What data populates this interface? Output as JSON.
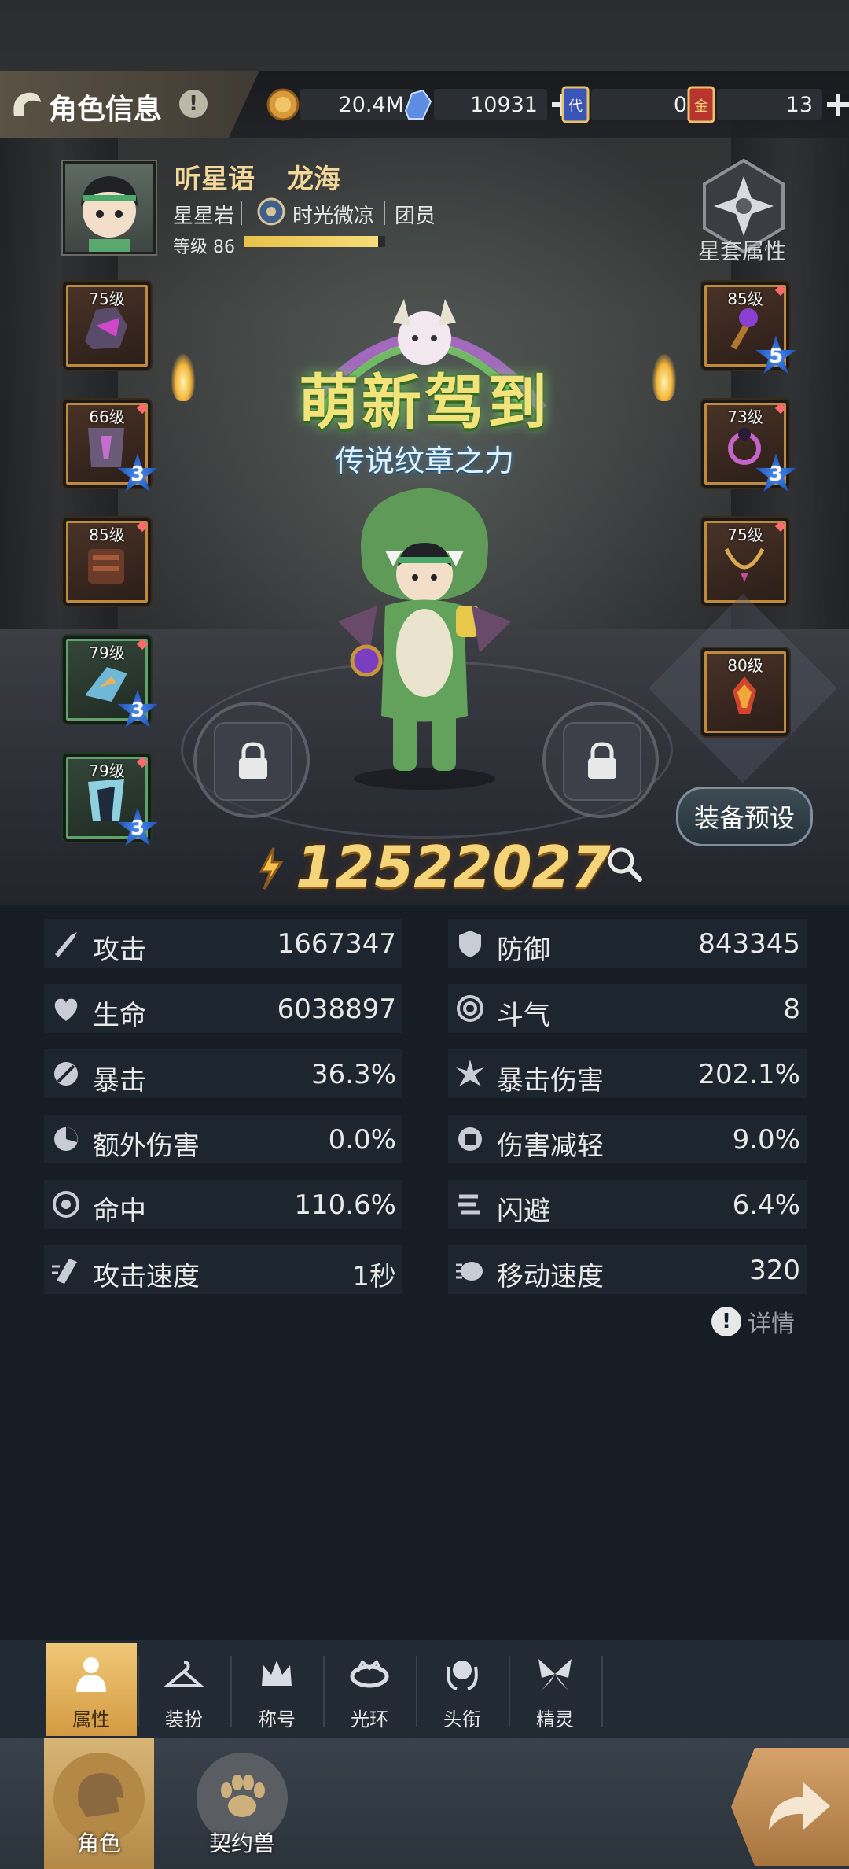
{
  "header": {
    "title": "角色信息",
    "resources": [
      {
        "icon": "gold-coin-icon",
        "value": "20.4M",
        "has_plus": false
      },
      {
        "icon": "blue-crystal-icon",
        "value": "10931",
        "has_plus": true
      },
      {
        "icon": "blue-card-icon",
        "value": "0",
        "has_plus": false
      },
      {
        "icon": "red-card-icon",
        "value": "13",
        "has_plus": true
      }
    ]
  },
  "character": {
    "name": "听星语",
    "title": "龙海",
    "server": "星星岩",
    "guild": "时光微凉",
    "rank": "团员",
    "level_label": "等级 86",
    "level_progress": 0.95,
    "star_set_label": "星套属性"
  },
  "equipment": {
    "left": [
      {
        "level": "75级",
        "stars": null,
        "frame": "orange",
        "dot": false
      },
      {
        "level": "66级",
        "stars": "3",
        "frame": "orange",
        "dot": true
      },
      {
        "level": "85级",
        "stars": null,
        "frame": "orange",
        "dot": true
      },
      {
        "level": "79级",
        "stars": "3",
        "frame": "green",
        "dot": true
      },
      {
        "level": "79级",
        "stars": "3",
        "frame": "green",
        "dot": true
      }
    ],
    "right": [
      {
        "level": "85级",
        "stars": "5",
        "frame": "orange",
        "dot": true
      },
      {
        "level": "73级",
        "stars": "3",
        "frame": "orange",
        "dot": true
      },
      {
        "level": "75级",
        "stars": null,
        "frame": "orange",
        "dot": true
      },
      {
        "level": "80级",
        "stars": null,
        "frame": "orange",
        "dot": false
      }
    ]
  },
  "badge": {
    "title": "萌新驾到",
    "subtitle": "传说纹章之力"
  },
  "preset_button": "装备预设",
  "combat_power": "12522027",
  "stats": [
    {
      "label": "攻击",
      "value": "1667347",
      "icon": "sword-icon"
    },
    {
      "label": "防御",
      "value": "843345",
      "icon": "shield-icon"
    },
    {
      "label": "生命",
      "value": "6038897",
      "icon": "heart-icon"
    },
    {
      "label": "斗气",
      "value": "8",
      "icon": "swirl-icon"
    },
    {
      "label": "暴击",
      "value": "36.3%",
      "icon": "crit-icon"
    },
    {
      "label": "暴击伤害",
      "value": "202.1%",
      "icon": "burst-icon"
    },
    {
      "label": "额外伤害",
      "value": "0.0%",
      "icon": "extra-damage-icon"
    },
    {
      "label": "伤害减轻",
      "value": "9.0%",
      "icon": "damage-reduction-icon"
    },
    {
      "label": "命中",
      "value": "110.6%",
      "icon": "target-icon"
    },
    {
      "label": "闪避",
      "value": "6.4%",
      "icon": "dodge-icon"
    },
    {
      "label": "攻击速度",
      "value": "1秒",
      "icon": "attack-speed-icon"
    },
    {
      "label": "移动速度",
      "value": "320",
      "icon": "move-speed-icon"
    }
  ],
  "details_label": "详情",
  "sub_tabs": [
    {
      "label": "属性",
      "icon": "person-icon",
      "selected": true
    },
    {
      "label": "装扮",
      "icon": "hanger-icon",
      "selected": false
    },
    {
      "label": "称号",
      "icon": "crown-icon",
      "selected": false
    },
    {
      "label": "光环",
      "icon": "halo-icon",
      "selected": false
    },
    {
      "label": "头衔",
      "icon": "emblem-icon",
      "selected": false
    },
    {
      "label": "精灵",
      "icon": "fairy-icon",
      "selected": false
    }
  ],
  "bottom_tabs": [
    {
      "label": "角色",
      "icon": "character-icon",
      "selected": true
    },
    {
      "label": "契约兽",
      "icon": "paw-icon",
      "selected": false
    }
  ],
  "colors": {
    "accent_gold": "#f1c878",
    "power_text": "#f6d47a",
    "name_text": "#f3d89a",
    "panel_bg": "#161d24"
  }
}
